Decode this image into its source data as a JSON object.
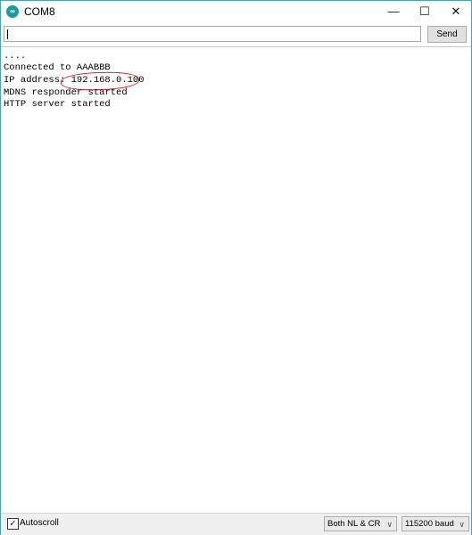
{
  "window": {
    "title": "COM8",
    "app_icon": "arduino-icon",
    "controls": {
      "minimize": "—",
      "maximize": "☐",
      "close": "✕"
    }
  },
  "input_bar": {
    "value": "",
    "send_label": "Send"
  },
  "output": {
    "lines": [
      "....",
      "Connected to AAABBB",
      "IP address: 192.168.0.100",
      "MDNS responder started",
      "HTTP server started"
    ],
    "annotation_color": "#c8202a"
  },
  "footer": {
    "autoscroll_label": "Autoscroll",
    "autoscroll_checked": true,
    "checkmark": "✓",
    "line_ending": "Both NL & CR",
    "baud_rate": "115200 baud",
    "chevron": "∨"
  }
}
